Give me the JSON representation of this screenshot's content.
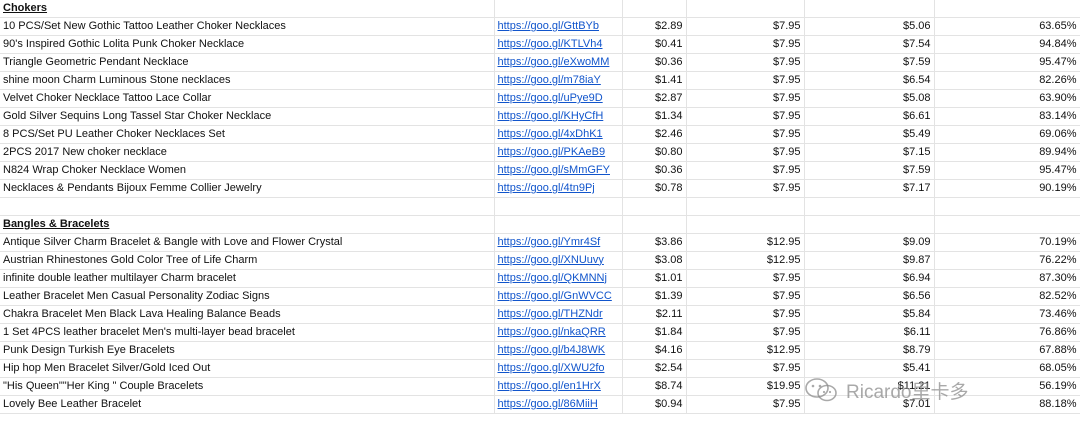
{
  "sections": [
    {
      "title": "Chokers",
      "rows": [
        {
          "name": "10 PCS/Set New Gothic Tattoo Leather Choker Necklaces",
          "link": "https://goo.gl/GttBYb",
          "cost": "$2.89",
          "price": "$7.95",
          "profit": "$5.06",
          "margin": "63.65%"
        },
        {
          "name": "90's Inspired Gothic Lolita Punk Choker Necklace",
          "link": "https://goo.gl/KTLVh4",
          "cost": "$0.41",
          "price": "$7.95",
          "profit": "$7.54",
          "margin": "94.84%"
        },
        {
          "name": "Triangle Geometric Pendant Necklace",
          "link": "https://goo.gl/eXwoMM",
          "cost": "$0.36",
          "price": "$7.95",
          "profit": "$7.59",
          "margin": "95.47%"
        },
        {
          "name": "shine moon Charm Luminous Stone necklaces",
          "link": "https://goo.gl/m78iaY",
          "cost": "$1.41",
          "price": "$7.95",
          "profit": "$6.54",
          "margin": "82.26%"
        },
        {
          "name": "Velvet Choker Necklace Tattoo Lace Collar",
          "link": "https://goo.gl/uPye9D",
          "cost": "$2.87",
          "price": "$7.95",
          "profit": "$5.08",
          "margin": "63.90%"
        },
        {
          "name": "Gold Silver Sequins Long Tassel Star Choker Necklace",
          "link": "https://goo.gl/KHyCfH",
          "cost": "$1.34",
          "price": "$7.95",
          "profit": "$6.61",
          "margin": "83.14%"
        },
        {
          "name": "8 PCS/Set PU Leather Choker Necklaces Set",
          "link": "https://goo.gl/4xDhK1",
          "cost": "$2.46",
          "price": "$7.95",
          "profit": "$5.49",
          "margin": "69.06%"
        },
        {
          "name": "2PCS 2017 New choker necklace",
          "link": "https://goo.gl/PKAeB9",
          "cost": "$0.80",
          "price": "$7.95",
          "profit": "$7.15",
          "margin": "89.94%"
        },
        {
          "name": "N824 Wrap Choker Necklace Women",
          "link": "https://goo.gl/sMmGFY",
          "cost": "$0.36",
          "price": "$7.95",
          "profit": "$7.59",
          "margin": "95.47%"
        },
        {
          "name": "Necklaces & Pendants Bijoux Femme Collier Jewelry",
          "link": "https://goo.gl/4tn9Pj",
          "cost": "$0.78",
          "price": "$7.95",
          "profit": "$7.17",
          "margin": "90.19%"
        }
      ]
    },
    {
      "title": "Bangles & Bracelets",
      "rows": [
        {
          "name": "Antique Silver Charm Bracelet & Bangle with Love and Flower Crystal",
          "link": "https://goo.gl/Ymr4Sf",
          "cost": "$3.86",
          "price": "$12.95",
          "profit": "$9.09",
          "margin": "70.19%"
        },
        {
          "name": "Austrian Rhinestones Gold Color Tree of Life Charm",
          "link": "https://goo.gl/XNUuvy",
          "cost": "$3.08",
          "price": "$12.95",
          "profit": "$9.87",
          "margin": "76.22%"
        },
        {
          "name": "infinite double leather multilayer Charm bracelet",
          "link": "https://goo.gl/QKMNNj",
          "cost": "$1.01",
          "price": "$7.95",
          "profit": "$6.94",
          "margin": "87.30%"
        },
        {
          "name": "Leather Bracelet Men Casual Personality Zodiac Signs",
          "link": "https://goo.gl/GnWVCC",
          "cost": "$1.39",
          "price": "$7.95",
          "profit": "$6.56",
          "margin": "82.52%"
        },
        {
          "name": "Chakra Bracelet Men Black Lava Healing Balance Beads",
          "link": "https://goo.gl/THZNdr",
          "cost": "$2.11",
          "price": "$7.95",
          "profit": "$5.84",
          "margin": "73.46%"
        },
        {
          "name": "1 Set 4PCS leather bracelet Men's multi-layer bead bracelet",
          "link": "https://goo.gl/nkaQRR",
          "cost": "$1.84",
          "price": "$7.95",
          "profit": "$6.11",
          "margin": "76.86%"
        },
        {
          "name": "Punk Design Turkish Eye Bracelets",
          "link": "https://goo.gl/b4J8WK",
          "cost": "$4.16",
          "price": "$12.95",
          "profit": "$8.79",
          "margin": "67.88%"
        },
        {
          "name": "Hip hop Men Bracelet Silver/Gold Iced Out",
          "link": "https://goo.gl/XWU2fo",
          "cost": "$2.54",
          "price": "$7.95",
          "profit": "$5.41",
          "margin": "68.05%"
        },
        {
          "name": "\"His Queen\"\"Her King \" Couple Bracelets",
          "link": "https://goo.gl/en1HrX",
          "cost": "$8.74",
          "price": "$19.95",
          "profit": "$11.21",
          "margin": "56.19%"
        },
        {
          "name": "Lovely Bee Leather Bracelet",
          "link": "https://goo.gl/86MiiH",
          "cost": "$0.94",
          "price": "$7.95",
          "profit": "$7.01",
          "margin": "88.18%"
        }
      ]
    }
  ],
  "watermark": {
    "text": "Ricardo里卡多",
    "icon": "wechat-icon"
  }
}
